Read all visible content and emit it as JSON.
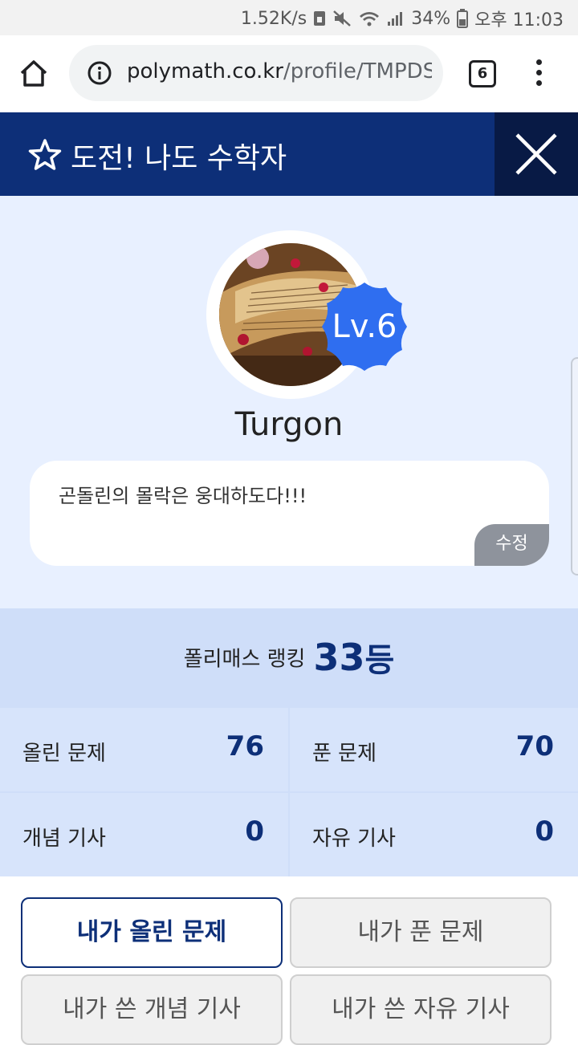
{
  "status_bar": {
    "speed": "1.52K/s",
    "battery": "34%",
    "time": "오후 11:03"
  },
  "browser": {
    "url_domain": "polymath.co.kr",
    "url_path": "/profile/TMPDS",
    "tab_count": "6"
  },
  "header": {
    "title": "도전! 나도 수학자"
  },
  "profile": {
    "level": "Lv.6",
    "username": "Turgon",
    "bio": "곤돌린의 몰락은 웅대하도다!!!",
    "edit_label": "수정"
  },
  "ranking": {
    "label": "폴리매스 랭킹",
    "value": "33",
    "suffix": "등"
  },
  "stats": [
    {
      "label": "올린 문제",
      "value": "76"
    },
    {
      "label": "푼 문제",
      "value": "70"
    },
    {
      "label": "개념 기사",
      "value": "0"
    },
    {
      "label": "자유 기사",
      "value": "0"
    }
  ],
  "tabs": [
    {
      "label": "내가 올린 문제",
      "active": true
    },
    {
      "label": "내가 푼 문제",
      "active": false
    },
    {
      "label": "내가 쓴 개념 기사",
      "active": false
    },
    {
      "label": "내가 쓴 자유 기사",
      "active": false
    }
  ],
  "colors": {
    "primary": "#0d2f78",
    "header_dark": "#081a45",
    "badge_blue": "#2f6ef0",
    "profile_bg": "#e8f0ff",
    "stats_bg": "#cfdef9"
  }
}
